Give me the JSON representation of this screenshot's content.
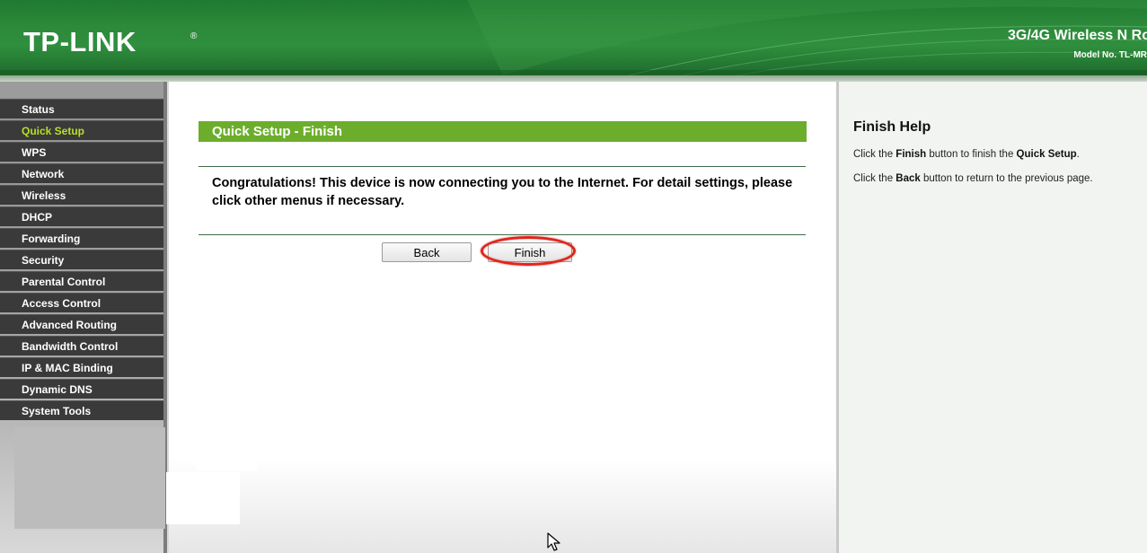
{
  "header": {
    "logo": "TP-LINK",
    "logo_mark": "®",
    "product_name": "3G/4G Wireless N Ro",
    "model_no": "Model No. TL-MR"
  },
  "sidebar": {
    "items": [
      {
        "label": "Status"
      },
      {
        "label": "Quick Setup",
        "active": true
      },
      {
        "label": "WPS"
      },
      {
        "label": "Network"
      },
      {
        "label": "Wireless"
      },
      {
        "label": "DHCP"
      },
      {
        "label": "Forwarding"
      },
      {
        "label": "Security"
      },
      {
        "label": "Parental Control"
      },
      {
        "label": "Access Control"
      },
      {
        "label": "Advanced Routing"
      },
      {
        "label": "Bandwidth Control"
      },
      {
        "label": "IP & MAC Binding"
      },
      {
        "label": "Dynamic DNS"
      },
      {
        "label": "System Tools"
      }
    ]
  },
  "main": {
    "section_title": "Quick Setup - Finish",
    "message": "Congratulations! This device is now connecting you to the Internet. For detail settings, please click other menus if necessary.",
    "back_label": "Back",
    "finish_label": "Finish"
  },
  "help": {
    "title": "Finish Help",
    "line1": {
      "pre": "Click the ",
      "b1": "Finish",
      "mid": " button to finish the ",
      "b2": "Quick Setup",
      "post": "."
    },
    "line2": {
      "pre": "Click the ",
      "b1": "Back",
      "post": " button to return to the previous page."
    }
  },
  "colors": {
    "header_green": "#2c8a3a",
    "title_bar_green": "#6cae2c",
    "active_menu": "#b6e026",
    "menu_bg": "#3a3a3a",
    "highlight_red": "#e0251b"
  }
}
